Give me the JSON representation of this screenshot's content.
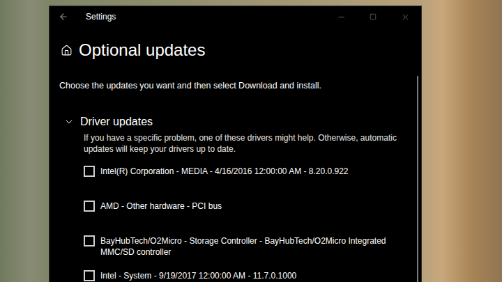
{
  "window": {
    "title": "Settings"
  },
  "page": {
    "title": "Optional updates",
    "instructions": "Choose the updates you want and then select Download and install."
  },
  "sections": [
    {
      "title": "Driver updates",
      "expanded": true,
      "description": "If you have a specific problem, one of these drivers might help. Otherwise, automatic updates will keep your drivers up to date.",
      "items": [
        {
          "label": "Intel(R) Corporation - MEDIA - 4/16/2016 12:00:00 AM - 8.20.0.922",
          "checked": false
        },
        {
          "label": "AMD - Other hardware - PCI bus",
          "checked": false
        },
        {
          "label": "BayHubTech/O2Micro - Storage Controller - BayHubTech/O2Micro Integrated MMC/SD controller",
          "checked": false
        },
        {
          "label": "Intel - System - 9/19/2017 12:00:00 AM - 11.7.0.1000",
          "checked": false
        }
      ]
    }
  ]
}
